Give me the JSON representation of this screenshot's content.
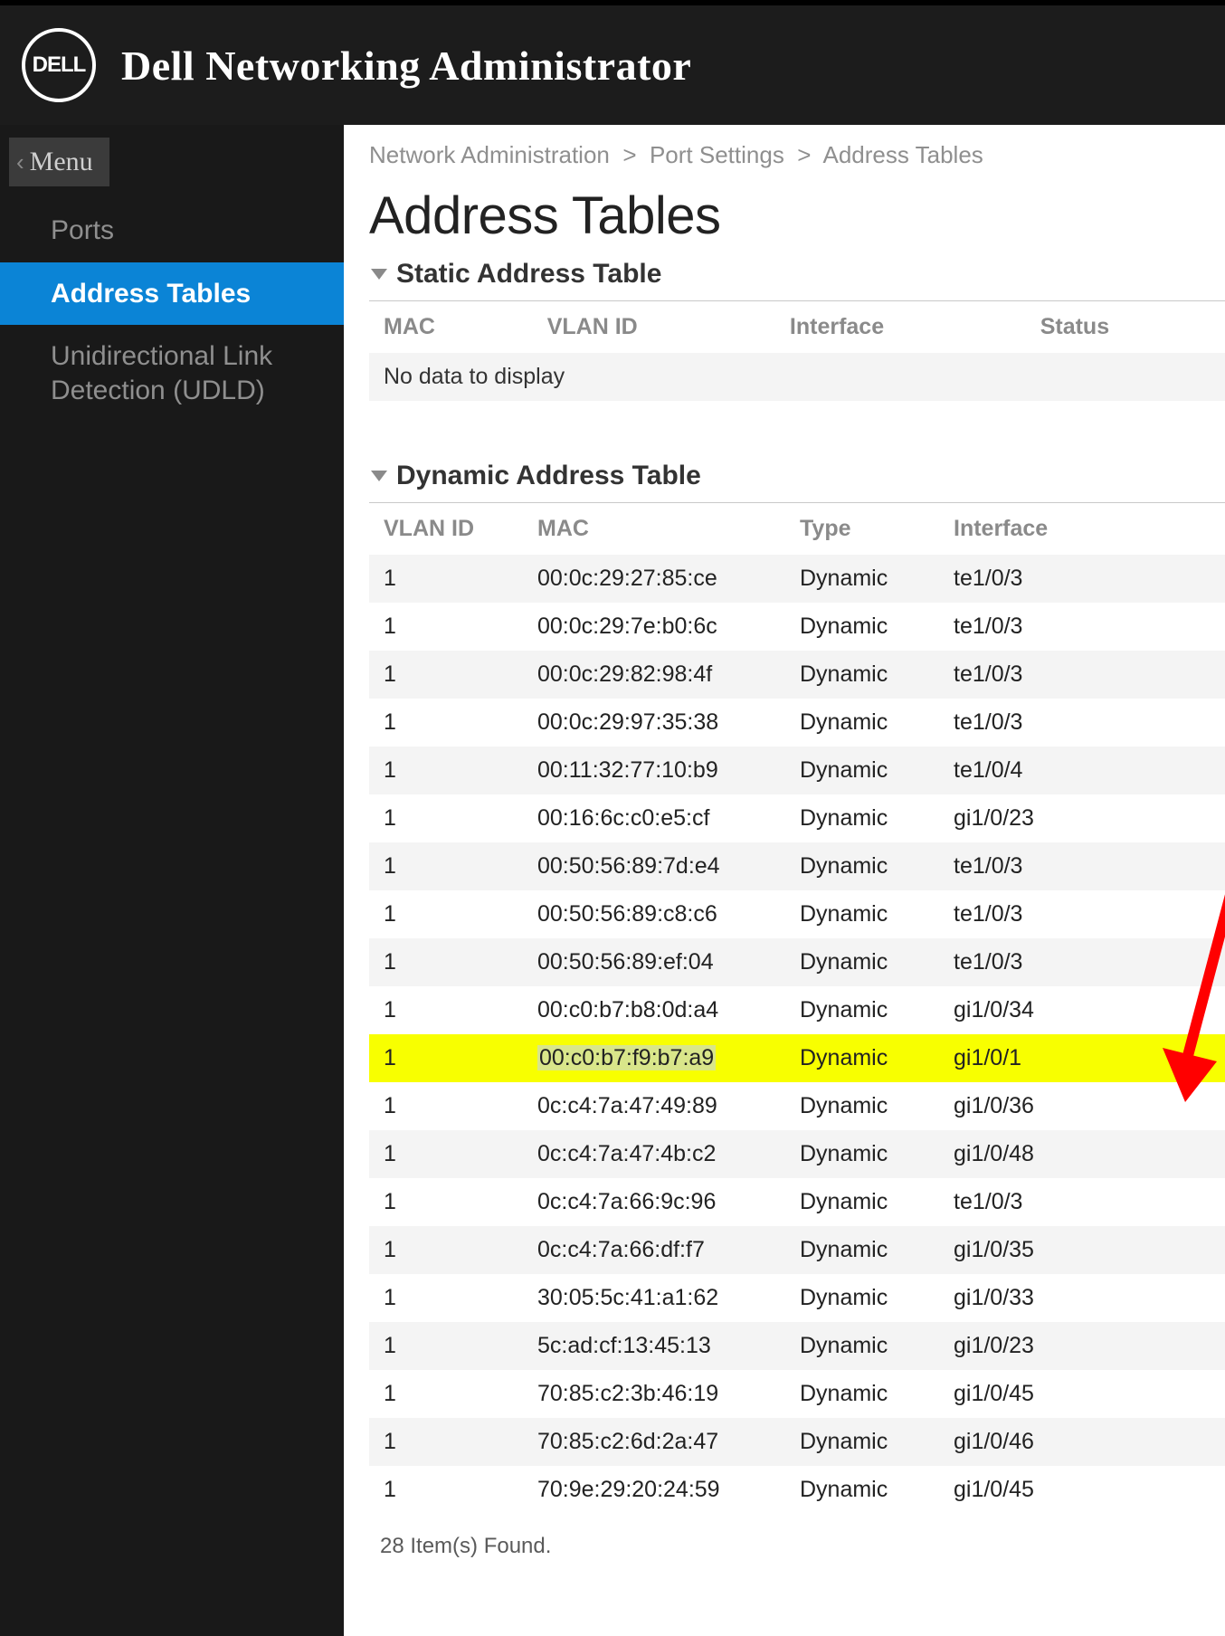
{
  "header": {
    "logo_text": "DELL",
    "title": "Dell Networking Administrator"
  },
  "sidebar": {
    "menu_back_label": "Menu",
    "items": [
      {
        "label": "Ports",
        "active": false
      },
      {
        "label": "Address Tables",
        "active": true
      },
      {
        "label": "Unidirectional Link Detection (UDLD)",
        "active": false
      }
    ]
  },
  "breadcrumb": {
    "path": [
      "Network Administration",
      "Port Settings",
      "Address Tables"
    ]
  },
  "page": {
    "title": "Address Tables"
  },
  "static_table": {
    "title": "Static Address Table",
    "columns": [
      "MAC",
      "VLAN ID",
      "Interface",
      "Status"
    ],
    "no_data_text": "No data to display"
  },
  "dynamic_table": {
    "title": "Dynamic Address Table",
    "columns": [
      "VLAN ID",
      "MAC",
      "Type",
      "Interface"
    ],
    "rows": [
      {
        "vlan": "1",
        "mac": "00:0c:29:27:85:ce",
        "type": "Dynamic",
        "iface": "te1/0/3",
        "highlight": false
      },
      {
        "vlan": "1",
        "mac": "00:0c:29:7e:b0:6c",
        "type": "Dynamic",
        "iface": "te1/0/3",
        "highlight": false
      },
      {
        "vlan": "1",
        "mac": "00:0c:29:82:98:4f",
        "type": "Dynamic",
        "iface": "te1/0/3",
        "highlight": false
      },
      {
        "vlan": "1",
        "mac": "00:0c:29:97:35:38",
        "type": "Dynamic",
        "iface": "te1/0/3",
        "highlight": false
      },
      {
        "vlan": "1",
        "mac": "00:11:32:77:10:b9",
        "type": "Dynamic",
        "iface": "te1/0/4",
        "highlight": false
      },
      {
        "vlan": "1",
        "mac": "00:16:6c:c0:e5:cf",
        "type": "Dynamic",
        "iface": "gi1/0/23",
        "highlight": false
      },
      {
        "vlan": "1",
        "mac": "00:50:56:89:7d:e4",
        "type": "Dynamic",
        "iface": "te1/0/3",
        "highlight": false
      },
      {
        "vlan": "1",
        "mac": "00:50:56:89:c8:c6",
        "type": "Dynamic",
        "iface": "te1/0/3",
        "highlight": false
      },
      {
        "vlan": "1",
        "mac": "00:50:56:89:ef:04",
        "type": "Dynamic",
        "iface": "te1/0/3",
        "highlight": false
      },
      {
        "vlan": "1",
        "mac": "00:c0:b7:b8:0d:a4",
        "type": "Dynamic",
        "iface": "gi1/0/34",
        "highlight": false
      },
      {
        "vlan": "1",
        "mac": "00:c0:b7:f9:b7:a9",
        "type": "Dynamic",
        "iface": "gi1/0/1",
        "highlight": true
      },
      {
        "vlan": "1",
        "mac": "0c:c4:7a:47:49:89",
        "type": "Dynamic",
        "iface": "gi1/0/36",
        "highlight": false
      },
      {
        "vlan": "1",
        "mac": "0c:c4:7a:47:4b:c2",
        "type": "Dynamic",
        "iface": "gi1/0/48",
        "highlight": false
      },
      {
        "vlan": "1",
        "mac": "0c:c4:7a:66:9c:96",
        "type": "Dynamic",
        "iface": "te1/0/3",
        "highlight": false
      },
      {
        "vlan": "1",
        "mac": "0c:c4:7a:66:df:f7",
        "type": "Dynamic",
        "iface": "gi1/0/35",
        "highlight": false
      },
      {
        "vlan": "1",
        "mac": "30:05:5c:41:a1:62",
        "type": "Dynamic",
        "iface": "gi1/0/33",
        "highlight": false
      },
      {
        "vlan": "1",
        "mac": "5c:ad:cf:13:45:13",
        "type": "Dynamic",
        "iface": "gi1/0/23",
        "highlight": false
      },
      {
        "vlan": "1",
        "mac": "70:85:c2:3b:46:19",
        "type": "Dynamic",
        "iface": "gi1/0/45",
        "highlight": false
      },
      {
        "vlan": "1",
        "mac": "70:85:c2:6d:2a:47",
        "type": "Dynamic",
        "iface": "gi1/0/46",
        "highlight": false
      },
      {
        "vlan": "1",
        "mac": "70:9e:29:20:24:59",
        "type": "Dynamic",
        "iface": "gi1/0/45",
        "highlight": false
      }
    ],
    "items_found_text": "28 Item(s) Found."
  },
  "annotation": {
    "arrow_color": "#ff0000"
  }
}
